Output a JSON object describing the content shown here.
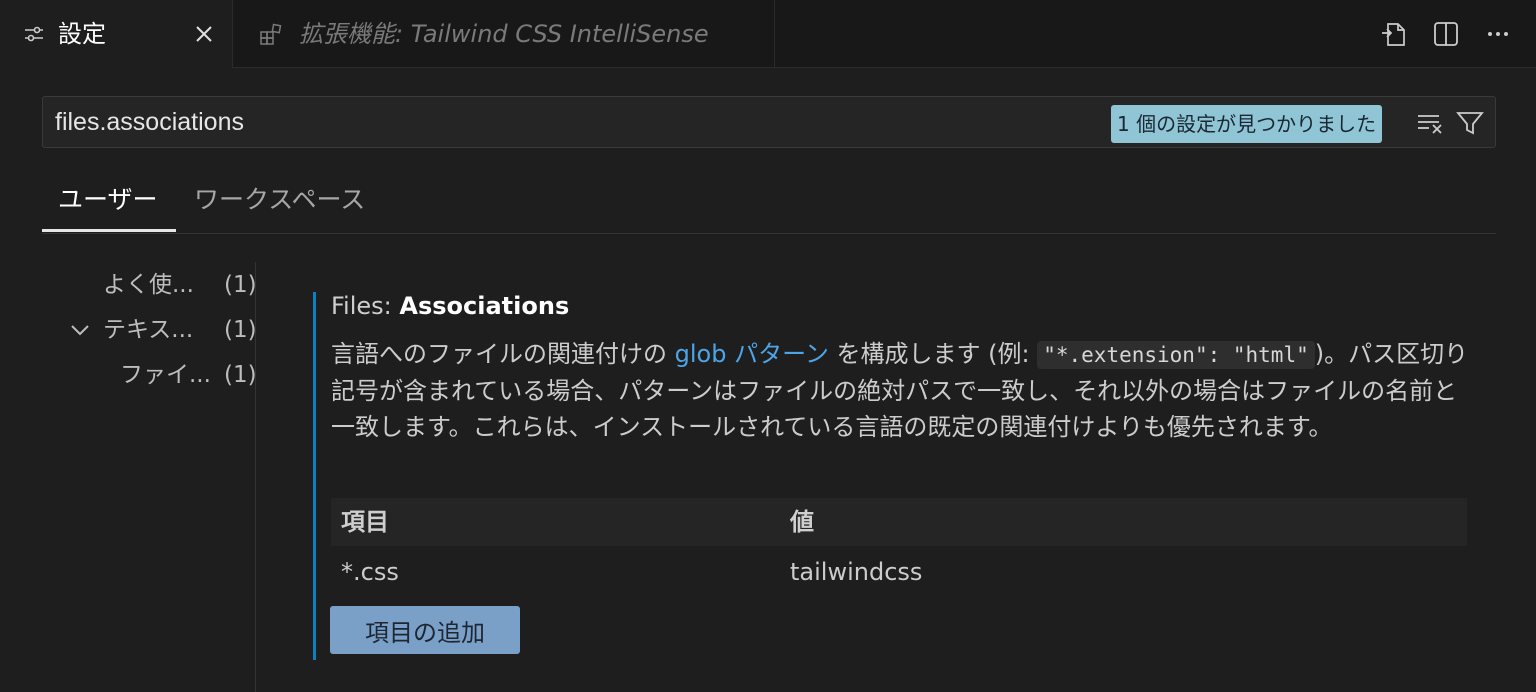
{
  "tabs": {
    "settings": {
      "label": "設定",
      "icon": "settings-sliders-icon"
    },
    "extension": {
      "label": "拡張機能: Tailwind CSS IntelliSense",
      "icon": "extensions-icon"
    }
  },
  "search": {
    "value": "files.associations",
    "result_badge": "1 個の設定が見つかりました"
  },
  "scope_tabs": [
    "ユーザー",
    "ワークスペース"
  ],
  "toc": [
    {
      "label": "よく使...",
      "count": "(1)"
    },
    {
      "label": "テキス...",
      "count": "(1)"
    },
    {
      "label": "ファイ...",
      "count": "(1)"
    }
  ],
  "setting": {
    "category": "Files: ",
    "name": "Associations",
    "desc_part1": "言語へのファイルの関連付けの ",
    "desc_link": "glob パターン",
    "desc_part2": " を構成します (例: ",
    "desc_code": "\"*.extension\": \"html\"",
    "desc_part3": ")。パス区切り記号が含まれている場合、パターンはファイルの絶対パスで一致し、それ以外の場合はファイルの名前と一致します。これらは、インストールされている言語の既定の関連付けよりも優先されます。",
    "table": {
      "headers": [
        "項目",
        "値"
      ],
      "rows": [
        [
          "*.css",
          "tailwindcss"
        ]
      ]
    },
    "add_button": "項目の追加"
  },
  "colors": {
    "accent_bar": "#0e7fbf",
    "badge": "#8fc5d4",
    "link": "#4ea4e6",
    "button": "#7aa0c8"
  }
}
